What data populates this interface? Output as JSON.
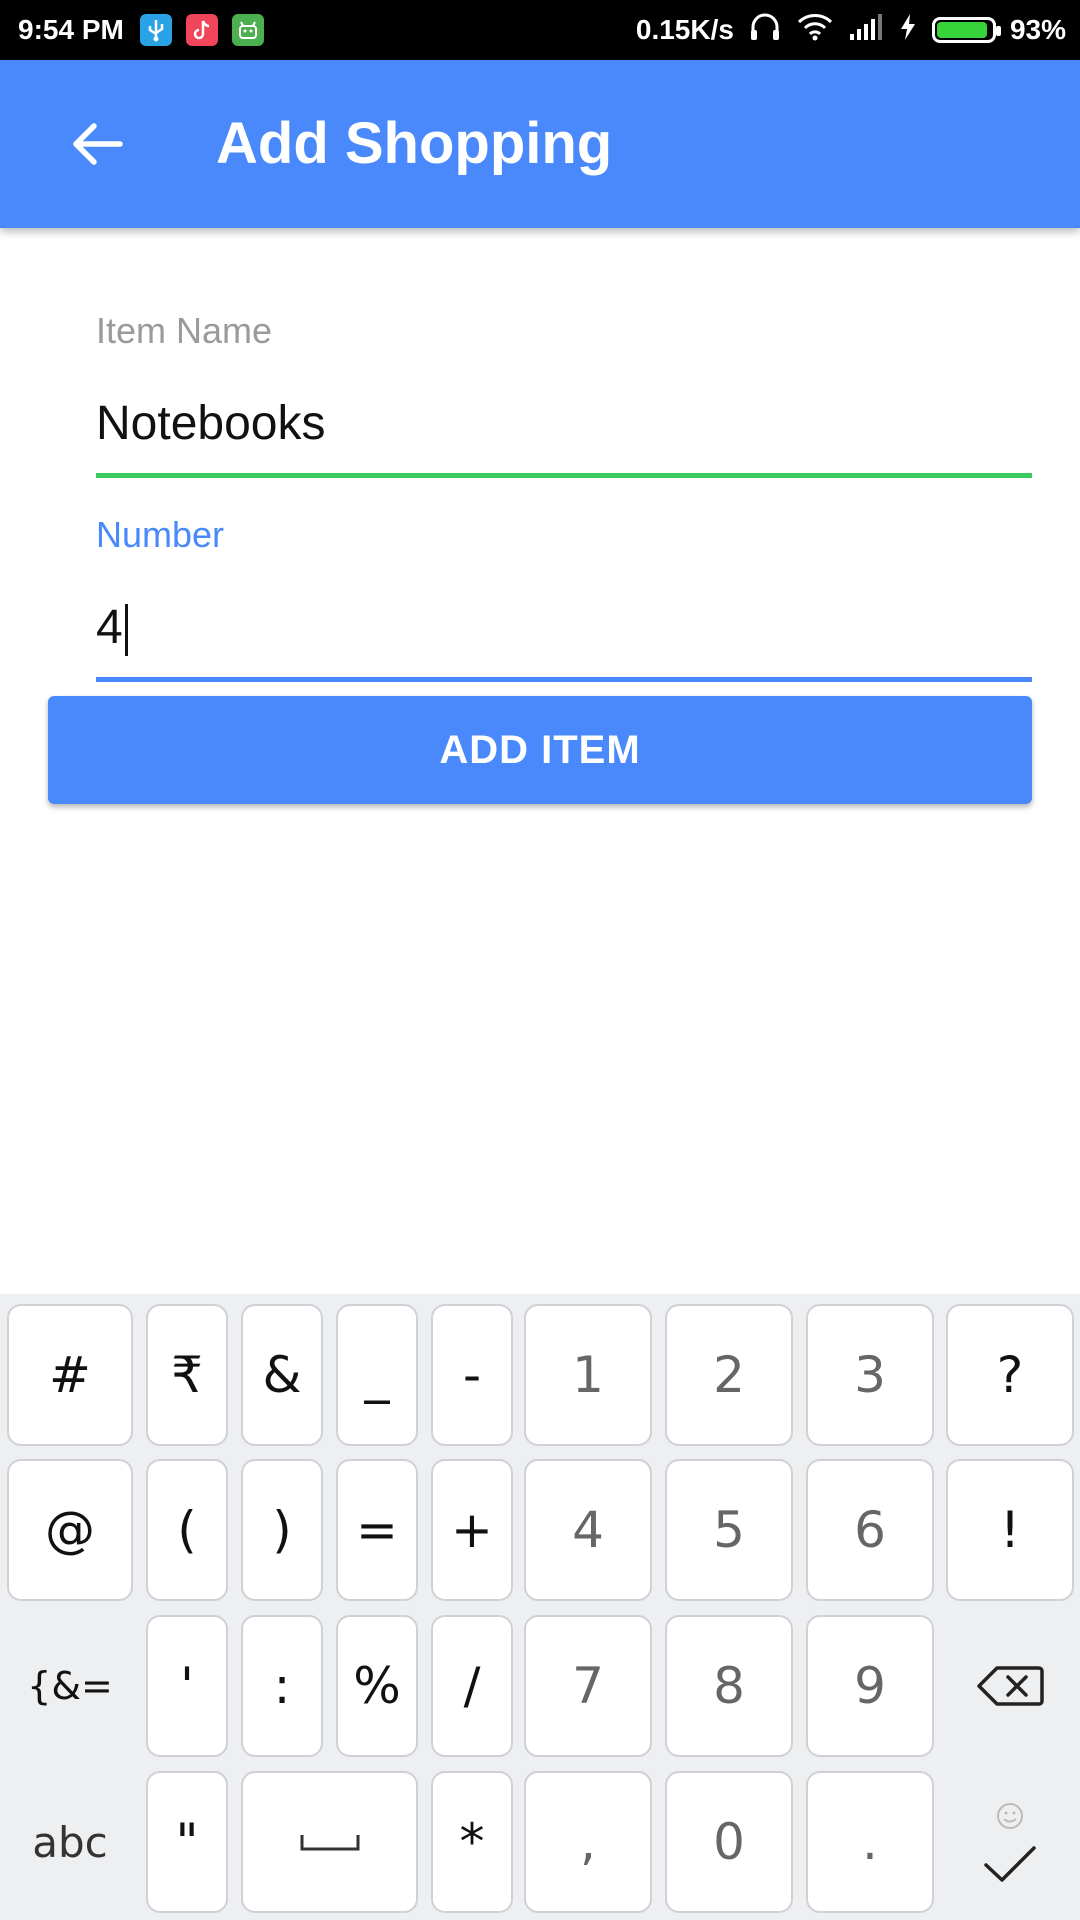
{
  "status_bar": {
    "time": "9:54 PM",
    "net_speed": "0.15K/s",
    "battery": "93%",
    "battery_level": 0.93,
    "icons": [
      "usb-icon",
      "tiktok-icon",
      "android-icon",
      "headphones-icon",
      "wifi-icon",
      "signal-icon",
      "charging-icon",
      "battery-icon"
    ]
  },
  "app_bar": {
    "title": "Add Shopping",
    "back_icon": "arrow-left-icon"
  },
  "form": {
    "item_name": {
      "label": "Item Name",
      "value": "Notebooks"
    },
    "number": {
      "label": "Number",
      "value": "4"
    },
    "submit_label": "ADD ITEM"
  },
  "keyboard": {
    "rows": [
      [
        "#",
        "₹",
        "&",
        "_",
        "-",
        "1",
        "2",
        "3",
        "?"
      ],
      [
        "@",
        "(",
        ")",
        "=",
        "+",
        "4",
        "5",
        "6",
        "!"
      ],
      [
        "{&=",
        "'",
        ":",
        "%",
        "/",
        "7",
        "8",
        "9",
        "backspace"
      ],
      [
        "abc",
        "\"",
        "space",
        "*",
        ",",
        "0",
        ".",
        "done"
      ]
    ]
  },
  "colors": {
    "primary": "#4a89fb",
    "accent_green": "#39cc5c",
    "label_gray": "#9a9a9a"
  }
}
